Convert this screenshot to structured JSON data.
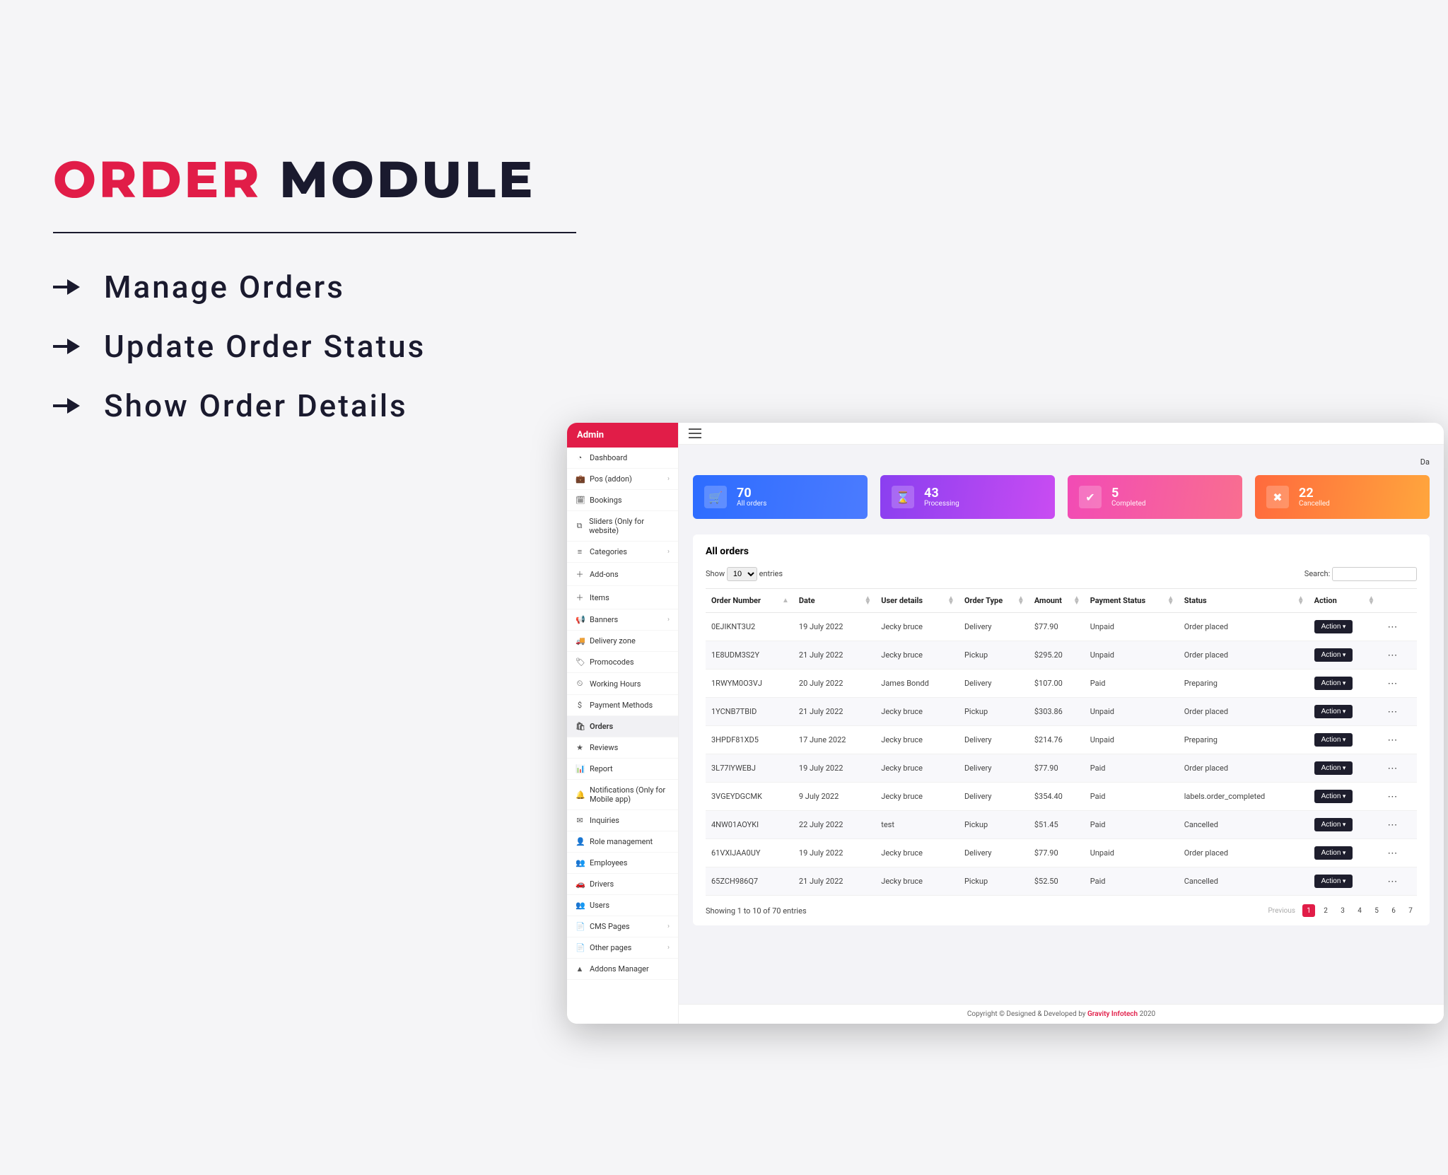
{
  "marketing": {
    "title_accent": "ORDER",
    "title_rest": " MODULE",
    "features": [
      "Manage Orders",
      "Update Order Status",
      "Show Order Details"
    ]
  },
  "sidebar": {
    "header": "Admin",
    "items": [
      {
        "icon": "◔",
        "label": "Dashboard",
        "chev": false
      },
      {
        "icon": "💼",
        "label": "Pos (addon)",
        "chev": true
      },
      {
        "icon": "🗓",
        "label": "Bookings",
        "chev": false
      },
      {
        "icon": "⧉",
        "label": "Sliders (Only for website)",
        "chev": false
      },
      {
        "icon": "≡",
        "label": "Categories",
        "chev": true
      },
      {
        "icon": "＋",
        "label": "Add-ons",
        "chev": false
      },
      {
        "icon": "＋",
        "label": "Items",
        "chev": false
      },
      {
        "icon": "📢",
        "label": "Banners",
        "chev": true
      },
      {
        "icon": "🚚",
        "label": "Delivery zone",
        "chev": false
      },
      {
        "icon": "🏷",
        "label": "Promocodes",
        "chev": false
      },
      {
        "icon": "⏲",
        "label": "Working Hours",
        "chev": false
      },
      {
        "icon": "$",
        "label": "Payment Methods",
        "chev": false
      },
      {
        "icon": "🛍",
        "label": "Orders",
        "chev": false,
        "active": true
      },
      {
        "icon": "★",
        "label": "Reviews",
        "chev": false
      },
      {
        "icon": "📊",
        "label": "Report",
        "chev": false
      },
      {
        "icon": "🔔",
        "label": "Notifications (Only for Mobile app)",
        "chev": false
      },
      {
        "icon": "✉",
        "label": "Inquiries",
        "chev": false
      },
      {
        "icon": "👤",
        "label": "Role management",
        "chev": false
      },
      {
        "icon": "👥",
        "label": "Employees",
        "chev": false
      },
      {
        "icon": "🚗",
        "label": "Drivers",
        "chev": false
      },
      {
        "icon": "👥",
        "label": "Users",
        "chev": false
      },
      {
        "icon": "📄",
        "label": "CMS Pages",
        "chev": true
      },
      {
        "icon": "📄",
        "label": "Other pages",
        "chev": true
      },
      {
        "icon": "▲",
        "label": "Addons Manager",
        "chev": false
      }
    ]
  },
  "breadcrumb": "Da",
  "stats": [
    {
      "num": "70",
      "label": "All orders",
      "icon": "🛒",
      "cls": "card-blue"
    },
    {
      "num": "43",
      "label": "Processing",
      "icon": "⌛",
      "cls": "card-purple"
    },
    {
      "num": "5",
      "label": "Completed",
      "icon": "✔",
      "cls": "card-pink"
    },
    {
      "num": "22",
      "label": "Cancelled",
      "icon": "✖",
      "cls": "card-orange"
    }
  ],
  "panel": {
    "title": "All orders",
    "show_prefix": "Show",
    "show_value": "10",
    "show_suffix": "entries",
    "search_label": "Search:",
    "columns": [
      "Order Number",
      "Date",
      "User details",
      "Order Type",
      "Amount",
      "Payment Status",
      "Status",
      "Action"
    ],
    "action_label": "Action",
    "rows": [
      {
        "num": "0EJIKNT3U2",
        "date": "19 July 2022",
        "user": "Jecky bruce",
        "type": "Delivery",
        "amount": "$77.90",
        "pay": "Unpaid",
        "status": "Order placed",
        "status_cls": ""
      },
      {
        "num": "1E8UDM3S2Y",
        "date": "21 July 2022",
        "user": "Jecky bruce",
        "type": "Pickup",
        "amount": "$295.20",
        "pay": "Unpaid",
        "status": "Order placed",
        "status_cls": ""
      },
      {
        "num": "1RWYM0O3VJ",
        "date": "20 July 2022",
        "user": "James Bondd",
        "type": "Delivery",
        "amount": "$107.00",
        "pay": "Paid",
        "status": "Preparing",
        "status_cls": "status-preparing"
      },
      {
        "num": "1YCNB7TBID",
        "date": "21 July 2022",
        "user": "Jecky bruce",
        "type": "Pickup",
        "amount": "$303.86",
        "pay": "Unpaid",
        "status": "Order placed",
        "status_cls": ""
      },
      {
        "num": "3HPDF81XD5",
        "date": "17 June 2022",
        "user": "Jecky bruce",
        "type": "Delivery",
        "amount": "$214.76",
        "pay": "Unpaid",
        "status": "Preparing",
        "status_cls": "status-preparing"
      },
      {
        "num": "3L77IYWEBJ",
        "date": "19 July 2022",
        "user": "Jecky bruce",
        "type": "Delivery",
        "amount": "$77.90",
        "pay": "Paid",
        "status": "Order placed",
        "status_cls": ""
      },
      {
        "num": "3VGEYDGCMK",
        "date": "9 July 2022",
        "user": "Jecky bruce",
        "type": "Delivery",
        "amount": "$354.40",
        "pay": "Paid",
        "status": "labels.order_completed",
        "status_cls": "status-completed"
      },
      {
        "num": "4NW01AOYKI",
        "date": "22 July 2022",
        "user": "test",
        "type": "Pickup",
        "amount": "$51.45",
        "pay": "Paid",
        "status": "Cancelled",
        "status_cls": "status-cancelled"
      },
      {
        "num": "61VXIJAA0UY",
        "date": "19 July 2022",
        "user": "Jecky bruce",
        "type": "Delivery",
        "amount": "$77.90",
        "pay": "Unpaid",
        "status": "Order placed",
        "status_cls": ""
      },
      {
        "num": "65ZCH986Q7",
        "date": "21 July 2022",
        "user": "Jecky bruce",
        "type": "Pickup",
        "amount": "$52.50",
        "pay": "Paid",
        "status": "Cancelled",
        "status_cls": "status-cancelled"
      }
    ],
    "footer_info": "Showing 1 to 10 of 70 entries",
    "pagination": {
      "prev": "Previous",
      "pages": [
        "1",
        "2",
        "3",
        "4",
        "5",
        "6",
        "7"
      ]
    }
  },
  "footer": {
    "prefix": "Copyright © Designed & Developed by ",
    "brand": "Gravity Infotech",
    "suffix": " 2020"
  }
}
